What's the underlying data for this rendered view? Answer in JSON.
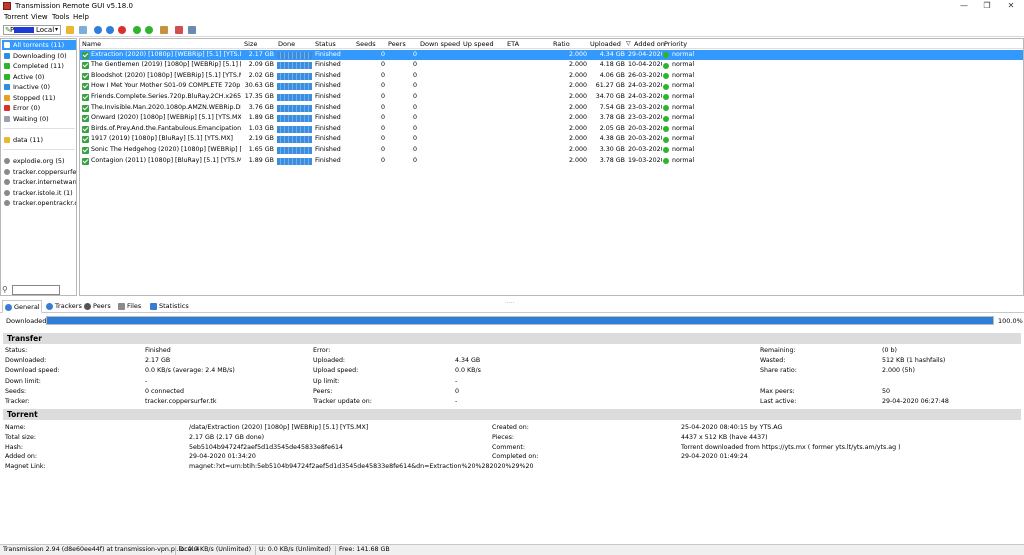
{
  "window": {
    "title": "Transmission Remote GUI v5.18.0"
  },
  "menu": [
    "Torrent",
    "View",
    "Tools",
    "Help"
  ],
  "toolbar": {
    "connection_label": "Local",
    "connection_prefix": "P"
  },
  "sidebar": {
    "items": [
      {
        "label": "All torrents (11)",
        "color": "#3399ff"
      },
      {
        "label": "Downloading (0)",
        "color": "#2d8de0"
      },
      {
        "label": "Completed (11)",
        "color": "#2db52d"
      },
      {
        "label": "Active (0)",
        "color": "#2db52d"
      },
      {
        "label": "Inactive (0)",
        "color": "#2d8de0"
      },
      {
        "label": "Stopped (11)",
        "color": "#e8a020"
      },
      {
        "label": "Error (0)",
        "color": "#d9302b"
      },
      {
        "label": "Waiting (0)",
        "color": "#9aa0a8"
      }
    ],
    "folders": [
      {
        "label": "data (11)"
      }
    ],
    "trackers": [
      {
        "label": "explodie.org (5)"
      },
      {
        "label": "tracker.coppersurfer.tk"
      },
      {
        "label": "tracker.internetwarrio"
      },
      {
        "label": "tracker.istole.it (1)"
      },
      {
        "label": "tracker.opentrackr.org"
      }
    ]
  },
  "list": {
    "columns": [
      "Name",
      "Size",
      "Done",
      "Status",
      "Seeds",
      "Peers",
      "Down speed",
      "Up speed",
      "ETA",
      "Ratio",
      "Uploaded",
      "Added on",
      "Priority"
    ],
    "sort_indicator": "▽",
    "rows": [
      {
        "name": "Extraction (2020) [1080p] [WEBRip] [5.1] [YTS.MX]",
        "size": "2.17 GB",
        "done": "100%",
        "status": "Finished",
        "seeds": "0",
        "peers": "0",
        "ratio": "2.000",
        "uploaded": "4.34 GB",
        "added": "29-04-2020 0",
        "priority": "normal"
      },
      {
        "name": "The Gentlemen (2019) [1080p] [WEBRip] [5.1] [YTS.MX",
        "size": "2.09 GB",
        "done": "100%",
        "status": "Finished",
        "seeds": "0",
        "peers": "0",
        "ratio": "2.000",
        "uploaded": "4.18 GB",
        "added": "10-04-2020 2",
        "priority": "normal"
      },
      {
        "name": "Bloodshot (2020) [1080p] [WEBRip] [5.1] [YTS.MX]",
        "size": "2.02 GB",
        "done": "100%",
        "status": "Finished",
        "seeds": "0",
        "peers": "0",
        "ratio": "2.000",
        "uploaded": "4.06 GB",
        "added": "26-03-2020 1",
        "priority": "normal"
      },
      {
        "name": "How I Met Your Mother S01-09 COMPLETE 720p x264",
        "size": "30.63 GB",
        "done": "100%",
        "status": "Finished",
        "seeds": "0",
        "peers": "0",
        "ratio": "2.000",
        "uploaded": "61.27 GB",
        "added": "24-03-2020 1",
        "priority": "normal"
      },
      {
        "name": "Friends.Complete.Series.720p.BluRay.2CH.x265.HEVC",
        "size": "17.35 GB",
        "done": "100%",
        "status": "Finished",
        "seeds": "0",
        "peers": "0",
        "ratio": "2.000",
        "uploaded": "34.70 GB",
        "added": "24-03-2020 1",
        "priority": "normal"
      },
      {
        "name": "The.Invisible.Man.2020.1080p.AMZN.WEBRip.DDP5.1.",
        "size": "3.76 GB",
        "done": "100%",
        "status": "Finished",
        "seeds": "0",
        "peers": "0",
        "ratio": "2.000",
        "uploaded": "7.54 GB",
        "added": "23-03-2020 1",
        "priority": "normal"
      },
      {
        "name": "Onward (2020) [1080p] [WEBRip] [5.1] [YTS.MX]",
        "size": "1.89 GB",
        "done": "100%",
        "status": "Finished",
        "seeds": "0",
        "peers": "0",
        "ratio": "2.000",
        "uploaded": "3.78 GB",
        "added": "23-03-2020 1",
        "priority": "normal"
      },
      {
        "name": "Birds.of.Prey.And.the.Fantabulous.Emancipation.of.O",
        "size": "1.03 GB",
        "done": "100%",
        "status": "Finished",
        "seeds": "0",
        "peers": "0",
        "ratio": "2.000",
        "uploaded": "2.05 GB",
        "added": "20-03-2020 1",
        "priority": "normal"
      },
      {
        "name": "1917 (2019) [1080p] [BluRay] [5.1] [YTS.MX]",
        "size": "2.19 GB",
        "done": "100%",
        "status": "Finished",
        "seeds": "0",
        "peers": "0",
        "ratio": "2.000",
        "uploaded": "4.38 GB",
        "added": "20-03-2020 1",
        "priority": "normal"
      },
      {
        "name": "Sonic The Hedgehog (2020) [1080p] [WEBRip] [YTS.M",
        "size": "1.65 GB",
        "done": "100%",
        "status": "Finished",
        "seeds": "0",
        "peers": "0",
        "ratio": "2.000",
        "uploaded": "3.30 GB",
        "added": "20-03-2020 1",
        "priority": "normal"
      },
      {
        "name": "Contagion (2011) [1080p] [BluRay] [5.1] [YTS.MX]",
        "size": "1.89 GB",
        "done": "100%",
        "status": "Finished",
        "seeds": "0",
        "peers": "0",
        "ratio": "2.000",
        "uploaded": "3.78 GB",
        "added": "19-03-2020 1",
        "priority": "normal"
      }
    ]
  },
  "tabs": [
    "General",
    "Trackers",
    "Peers",
    "Files",
    "Statistics"
  ],
  "downloaded": {
    "label": "Downloaded:",
    "percent_text": "100.0%",
    "fraction": 1.0
  },
  "transfer": {
    "title": "Transfer",
    "col1": [
      {
        "k": "Status:",
        "v": "Finished"
      },
      {
        "k": "Downloaded:",
        "v": "2.17 GB"
      },
      {
        "k": "Download speed:",
        "v": "0.0 KB/s (average: 2.4 MB/s)"
      },
      {
        "k": "Down limit:",
        "v": "-"
      },
      {
        "k": "Seeds:",
        "v": "0 connected"
      },
      {
        "k": "Tracker:",
        "v": "tracker.coppersurfer.tk"
      }
    ],
    "col2": [
      {
        "k": "Error:",
        "v": ""
      },
      {
        "k": "Uploaded:",
        "v": "4.34 GB"
      },
      {
        "k": "Upload speed:",
        "v": "0.0 KB/s"
      },
      {
        "k": "Up limit:",
        "v": "-"
      },
      {
        "k": "Peers:",
        "v": "0"
      },
      {
        "k": "Tracker update on:",
        "v": "-"
      }
    ],
    "col3": [
      {
        "k": "Remaining:",
        "v": "(0 b)"
      },
      {
        "k": "Wasted:",
        "v": "512 KB (1 hashfails)"
      },
      {
        "k": "Share ratio:",
        "v": "2.000 (5h)"
      },
      {
        "k": "",
        "v": ""
      },
      {
        "k": "Max peers:",
        "v": "50"
      },
      {
        "k": "Last active:",
        "v": "29-04-2020 06:27:48"
      }
    ]
  },
  "torrent": {
    "title": "Torrent",
    "col1": [
      {
        "k": "Name:",
        "v": "/data/Extraction (2020) [1080p] [WEBRip] [5.1] [YTS.MX]"
      },
      {
        "k": "Total size:",
        "v": "2.17 GB (2.17 GB done)"
      },
      {
        "k": "Hash:",
        "v": "5eb5104b94724f2aef5d1d3545de45833e8fe614"
      },
      {
        "k": "Added on:",
        "v": "29-04-2020 01:34:20"
      },
      {
        "k": "Magnet Link:",
        "v": "magnet:?xt=urn:btih:5eb5104b94724f2aef5d1d3545de45833e8fe614&dn=Extraction%20%282020%29%20"
      }
    ],
    "col2": [
      {
        "k": "Created on:",
        "v": "25-04-2020 08:40:15 by YTS.AG"
      },
      {
        "k": "Pieces:",
        "v": "4437 x 512 KB (have 4437)"
      },
      {
        "k": "Comment:",
        "v": "Torrent downloaded from https://yts.mx ( former yts.lt/yts.am/yts.ag )"
      },
      {
        "k": "Completed on:",
        "v": "29-04-2020 01:49:24"
      }
    ]
  },
  "statusbar": {
    "server": "Transmission 2.94 (d8e60ee44f) at transmission-vpn.pi.local:4",
    "down": "D: 0.0 KB/s (Unlimited)",
    "up": "U: 0.0 KB/s (Unlimited)",
    "free": "Free: 141.68 GB"
  }
}
